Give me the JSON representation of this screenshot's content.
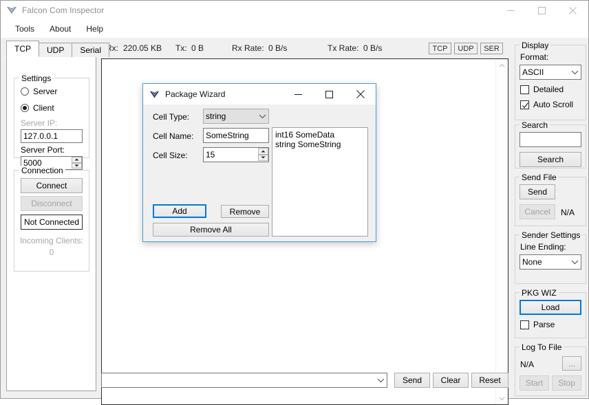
{
  "window": {
    "title": "Falcon Com Inspector",
    "logo_icon": "falcon-v-logo",
    "minimize_icon": "minimize-icon",
    "maximize_icon": "maximize-icon",
    "close_icon": "close-icon"
  },
  "menubar": {
    "items": [
      {
        "label": "Tools"
      },
      {
        "label": "About"
      },
      {
        "label": "Help"
      }
    ]
  },
  "tabs": [
    {
      "label": "TCP",
      "active": true
    },
    {
      "label": "UDP",
      "active": false
    },
    {
      "label": "Serial",
      "active": false
    }
  ],
  "settings": {
    "group_label": "Settings",
    "radio_server": "Server",
    "radio_client": "Client",
    "selected": "Client",
    "server_ip_label": "Server IP:",
    "server_ip_value": "127.0.0.1",
    "server_port_label": "Server Port:",
    "server_port_value": "5000"
  },
  "connection": {
    "group_label": "Connection",
    "connect_label": "Connect",
    "disconnect_label": "Disconnect",
    "status_label": "Not Connected",
    "incoming_clients_label": "Incoming Clients:",
    "incoming_clients_value": "0"
  },
  "stats": {
    "rx_label": "Rx:",
    "rx_value": "220.05 KB",
    "tx_label": "Tx:",
    "tx_value": "0 B",
    "rx_rate_label": "Rx Rate:",
    "rx_rate_value": "0 B/s",
    "tx_rate_label": "Tx Rate:",
    "tx_rate_value": "0 B/s",
    "badges": [
      "TCP",
      "UDP",
      "SER"
    ]
  },
  "log": {
    "content": "",
    "scroll_up_icon": "chevron-up-icon",
    "scroll_down_icon": "chevron-down-icon"
  },
  "sendbar": {
    "input_value": "",
    "dropdown_icon": "chevron-down-icon",
    "send_label": "Send",
    "clear_label": "Clear",
    "reset_label": "Reset"
  },
  "sidebar": {
    "display": {
      "group_label": "Display",
      "format_label": "Format:",
      "format_value": "ASCII",
      "detailed_label": "Detailed",
      "detailed_checked": false,
      "auto_scroll_label": "Auto Scroll",
      "auto_scroll_checked": true
    },
    "search": {
      "group_label": "Search",
      "input_value": "",
      "button_label": "Search"
    },
    "send_file": {
      "group_label": "Send File",
      "send_label": "Send",
      "cancel_label": "Cancel",
      "status_value": "N/A"
    },
    "sender_settings": {
      "group_label": "Sender Settings",
      "line_ending_label": "Line Ending:",
      "line_ending_value": "None"
    },
    "pkg_wiz": {
      "group_label": "PKG WIZ",
      "load_label": "Load",
      "parse_label": "Parse",
      "parse_checked": false
    },
    "log_to_file": {
      "group_label": "Log To File",
      "path_value": "N/A",
      "browse_label": "...",
      "start_label": "Start",
      "stop_label": "Stop"
    }
  },
  "dialog": {
    "title": "Package Wizard",
    "logo_icon": "falcon-v-logo",
    "minimize_icon": "minimize-icon",
    "maximize_icon": "maximize-icon",
    "close_icon": "close-icon",
    "cell_type_label": "Cell Type:",
    "cell_type_value": "string",
    "cell_name_label": "Cell Name:",
    "cell_name_value": "SomeString",
    "cell_size_label": "Cell Size:",
    "cell_size_value": "15",
    "add_label": "Add",
    "remove_label": "Remove",
    "remove_all_label": "Remove All",
    "list_items": [
      "int16 SomeData",
      "string SomeString"
    ]
  },
  "colors": {
    "accent": "#0078d7",
    "dialog_border": "#4a9ad4",
    "logo": "#2c3e6b",
    "background": "#f0f0f0"
  }
}
